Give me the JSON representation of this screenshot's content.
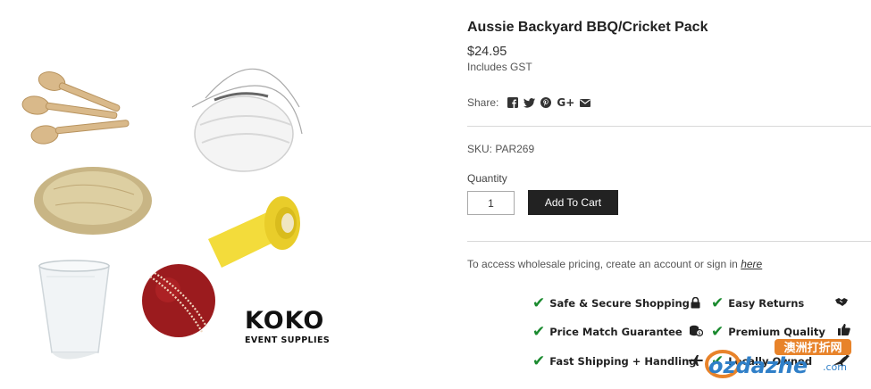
{
  "product": {
    "title": "Aussie Backyard BBQ/Cricket Pack",
    "price": "$24.95",
    "tax_note": "Includes GST",
    "sku": "SKU: PAR269",
    "quantity_label": "Quantity",
    "quantity_value": "1",
    "add_to_cart": "Add To Cart"
  },
  "share": {
    "label": "Share:",
    "icons": [
      "facebook-icon",
      "twitter-icon",
      "pinterest-icon",
      "google-plus-icon",
      "email-icon"
    ],
    "gplus_text": "G+"
  },
  "wholesale": {
    "text": "To access wholesale pricing, create an account or sign in",
    "link": "here"
  },
  "brand": {
    "name": "KOKO",
    "tagline": "EVENT SUPPLIES"
  },
  "guarantees": [
    {
      "label": "Safe & Secure Shopping",
      "icon": "lock-icon"
    },
    {
      "label": "Easy Returns",
      "icon": "handshake-icon"
    },
    {
      "label": "Price Match Guarantee",
      "icon": "coins-icon"
    },
    {
      "label": "Premium Quality",
      "icon": "thumbs-up-icon"
    },
    {
      "label": "Fast Shipping + Handling",
      "icon": "plane-icon"
    },
    {
      "label": "Locally Owned",
      "icon": "kangaroo-icon"
    }
  ],
  "watermark": {
    "chinese": "澳洲打折网",
    "latin": "ozdazhe",
    "suffix": ".com"
  },
  "colors": {
    "button_bg": "#222222",
    "check_green": "#1a8a2e",
    "cricket_ball": "#9b1b1e",
    "tape_yellow": "#f3dc3b"
  }
}
